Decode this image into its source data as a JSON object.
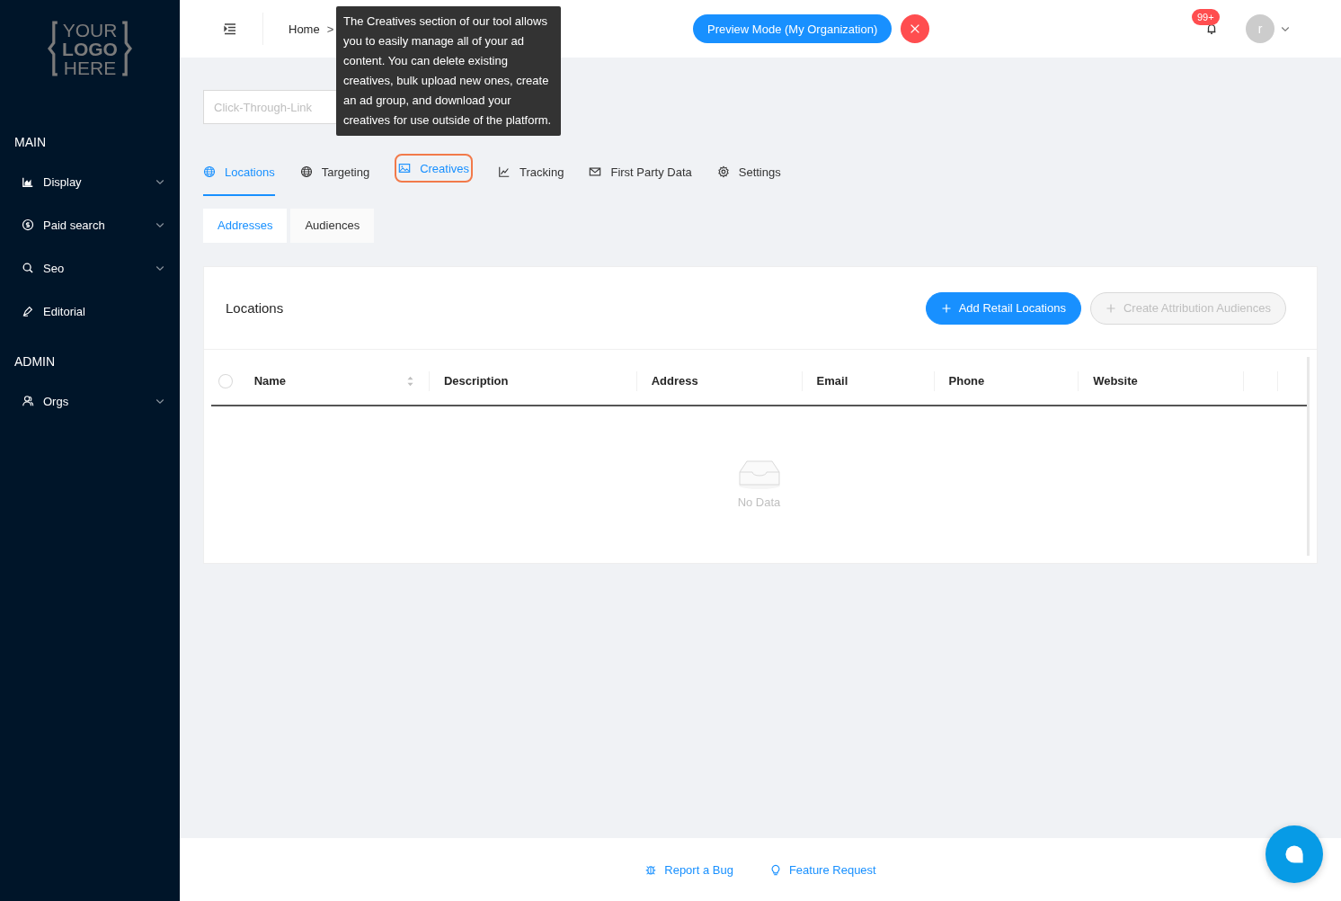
{
  "logo": {
    "lines": [
      "YOUR",
      "LOGO",
      "HERE"
    ]
  },
  "sidebar": {
    "sections": [
      {
        "title": "MAIN",
        "items": [
          {
            "label": "Display",
            "expandable": true
          },
          {
            "label": "Paid search",
            "expandable": true
          },
          {
            "label": "Seo",
            "expandable": true
          },
          {
            "label": "Editorial",
            "expandable": false
          }
        ]
      },
      {
        "title": "ADMIN",
        "items": [
          {
            "label": "Orgs",
            "expandable": true
          }
        ]
      }
    ]
  },
  "header": {
    "breadcrumb": [
      "Home"
    ],
    "separator": ">",
    "preview_button": "Preview Mode (My Organization)",
    "notification_count": "99+",
    "avatar_letter": "r"
  },
  "toolbar": {
    "link_field": {
      "placeholder": "Click-Through-Link"
    }
  },
  "tabs": [
    {
      "label": "Locations",
      "selected": true,
      "highlighted": false
    },
    {
      "label": "Targeting",
      "selected": false,
      "highlighted": false
    },
    {
      "label": "Creatives",
      "selected": false,
      "highlighted": true
    },
    {
      "label": "Tracking",
      "selected": false,
      "highlighted": false
    },
    {
      "label": "First Party Data",
      "selected": false,
      "highlighted": false
    },
    {
      "label": "Settings",
      "selected": false,
      "highlighted": false
    }
  ],
  "tooltip": "The Creatives section of our tool allows you to easily manage all of your ad content. You can delete existing creatives, bulk upload new ones, create an ad group, and download your creatives for use outside of the platform.",
  "subtabs": [
    {
      "label": "Addresses",
      "selected": true
    },
    {
      "label": "Audiences",
      "selected": false
    }
  ],
  "card": {
    "title": "Locations",
    "buttons": [
      {
        "label": "Add Retail Locations",
        "disabled": false
      },
      {
        "label": "Create Attribution Audiences",
        "disabled": true
      }
    ],
    "table": {
      "select_all": {
        "checked": false
      },
      "columns": [
        {
          "label": "Name",
          "sortable": true
        },
        {
          "label": "Description",
          "sortable": false
        },
        {
          "label": "Address",
          "sortable": false
        },
        {
          "label": "Email",
          "sortable": false
        },
        {
          "label": "Phone",
          "sortable": false
        },
        {
          "label": "Website",
          "sortable": false
        }
      ],
      "empty_text": "No Data"
    }
  },
  "footer": {
    "links": [
      {
        "label": "Report a Bug"
      },
      {
        "label": "Feature Request"
      }
    ]
  }
}
